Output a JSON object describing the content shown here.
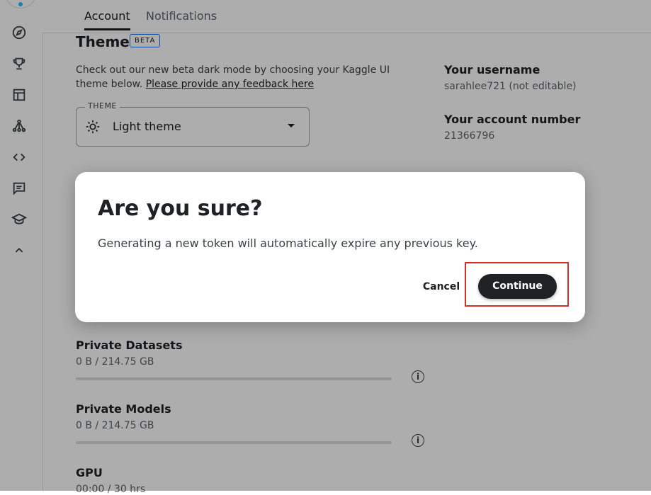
{
  "tabs": [
    {
      "label": "Account",
      "active": true
    },
    {
      "label": "Notifications",
      "active": false
    }
  ],
  "sidebar": {
    "items": [
      {
        "icon": "compass-icon"
      },
      {
        "icon": "trophy-icon"
      },
      {
        "icon": "table-icon"
      },
      {
        "icon": "models-icon"
      },
      {
        "icon": "code-icon"
      },
      {
        "icon": "discussion-icon"
      },
      {
        "icon": "learn-icon"
      },
      {
        "icon": "chevron-up-icon"
      }
    ]
  },
  "theme": {
    "heading": "Theme",
    "badge": "BETA",
    "description": "Check out our new beta dark mode by choosing your Kaggle UI theme below.",
    "feedback_link": "Please provide any feedback here",
    "select_label": "THEME",
    "select_value": "Light theme"
  },
  "account": {
    "username_title": "Your username",
    "username_value": "sarahlee721 (not editable)",
    "account_number_title": "Your account number",
    "account_number_value": "21366796"
  },
  "quotas": [
    {
      "title": "Private Datasets",
      "value": "0 B / 214.75 GB",
      "fraction": 0
    },
    {
      "title": "Private Models",
      "value": "0 B / 214.75 GB",
      "fraction": 0
    },
    {
      "title": "GPU",
      "value": "00:00 / 30 hrs",
      "fraction": 0
    }
  ],
  "dialog": {
    "title": "Are you sure?",
    "message": "Generating a new token will automatically expire any previous key.",
    "cancel_label": "Cancel",
    "continue_label": "Continue"
  },
  "colors": {
    "overlay": "rgba(0,0,0,0.32)",
    "primary_button": "#202124",
    "highlight": "#d32f2f"
  }
}
